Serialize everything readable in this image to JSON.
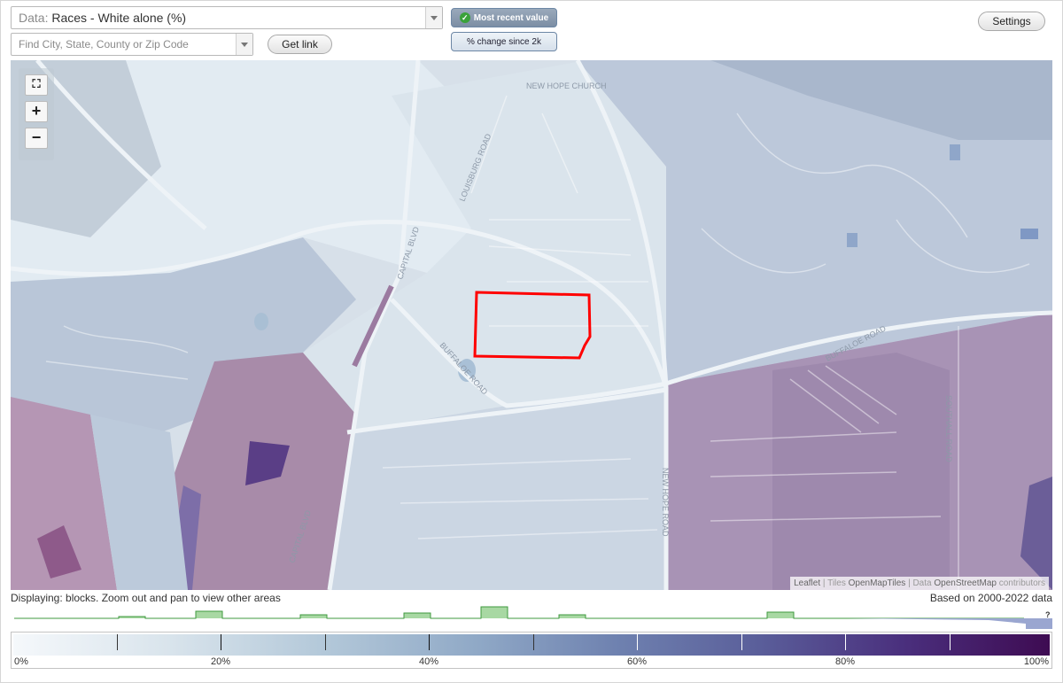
{
  "top": {
    "data_select": {
      "label": "Data:",
      "value": "Races - White alone (%)"
    },
    "search": {
      "placeholder": "Find City, State, County or Zip Code"
    },
    "get_link_label": "Get link",
    "toggle_recent_label": "Most recent value",
    "toggle_change_label": "% change since 2k",
    "settings_label": "Settings"
  },
  "map": {
    "road_labels": [
      "NEW HOPE CHURCH",
      "LOUISBURG ROAD",
      "CAPITAL BLVD",
      "BUFFALOE ROAD",
      "BUFFALOE ROAD",
      "NEW HOPE ROAD",
      "SOUTHALL ROAD",
      "CAPITAL BLVD"
    ],
    "attribution": {
      "leaflet": "Leaflet",
      "tiles_prefix": "Tiles",
      "tiles": "OpenMapTiles",
      "data_prefix": "Data",
      "data": "OpenStreetMap",
      "contributors": "contributors"
    },
    "selection_color": "#ff0000"
  },
  "status": {
    "displaying": "Displaying: blocks. Zoom out and pan to view other areas",
    "based_on": "Based on 2000-2022 data"
  },
  "histogram_marker": "?",
  "legend": {
    "labels": [
      "0%",
      "20%",
      "40%",
      "60%",
      "80%",
      "100%"
    ],
    "colors": {
      "low": "#f5f8fb",
      "mid": "#8fa8c6",
      "high": "#3e0b52"
    }
  }
}
